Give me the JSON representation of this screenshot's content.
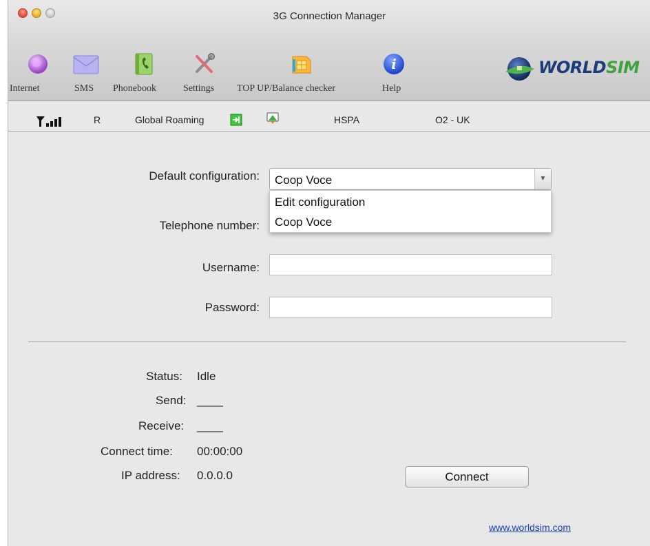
{
  "window": {
    "title": "3G Connection Manager"
  },
  "toolbar": {
    "items": [
      {
        "label": "Internet",
        "icon": "internet-globe-icon"
      },
      {
        "label": "SMS",
        "icon": "envelope-icon"
      },
      {
        "label": "Phonebook",
        "icon": "phonebook-icon"
      },
      {
        "label": "Settings",
        "icon": "tools-icon"
      },
      {
        "label": "TOP UP/Balance checker",
        "icon": "sim-card-icon"
      },
      {
        "label": "Help",
        "icon": "info-icon"
      }
    ],
    "logo": {
      "part1": "WORLD",
      "part2": "SIM"
    }
  },
  "status_strip": {
    "roaming_indicator": "R",
    "roaming_label": "Global Roaming",
    "network_type": "HSPA",
    "operator": "O2 - UK"
  },
  "form": {
    "default_configuration": {
      "label": "Default configuration:",
      "value": "Coop Voce",
      "options": [
        "Edit configuration",
        "Coop Voce"
      ]
    },
    "telephone_number": {
      "label": "Telephone number:",
      "value": ""
    },
    "username": {
      "label": "Username:",
      "value": ""
    },
    "password": {
      "label": "Password:",
      "value": ""
    }
  },
  "connection": {
    "status": {
      "label": "Status:",
      "value": "Idle"
    },
    "send": {
      "label": "Send:",
      "value": "____"
    },
    "receive": {
      "label": "Receive:",
      "value": "____"
    },
    "connect_time": {
      "label": "Connect time:",
      "value": "00:00:00"
    },
    "ip_address": {
      "label": "IP address:",
      "value": "0.0.0.0"
    },
    "connect_button": "Connect"
  },
  "footer": {
    "link": "www.worldsim.com"
  },
  "colors": {
    "logo_blue": "#1c3d7a",
    "logo_green": "#3ea23e",
    "link": "#1a3bbd"
  }
}
